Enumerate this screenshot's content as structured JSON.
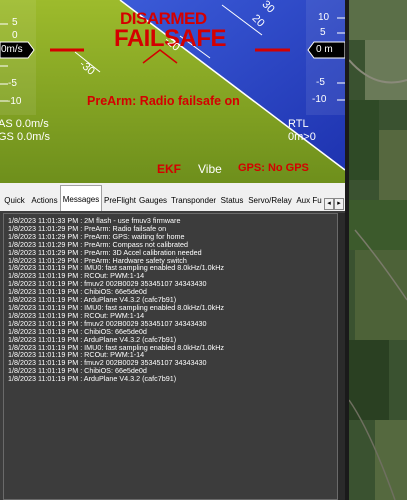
{
  "hud": {
    "status_armed": "DISARMED",
    "status_failsafe": "FAILSAFE",
    "prearm_message": "PreArm: Radio failsafe on",
    "left_speed_box": "0m/s",
    "right_alt_box": "0 m",
    "left_scale": [
      "5",
      "0",
      "-5",
      "-10"
    ],
    "right_scale": [
      "10",
      "5",
      "-5",
      "-10"
    ],
    "pitch_labels": [
      "30",
      "20",
      "-30",
      "-20"
    ],
    "airspeed": "AS 0.0m/s",
    "groundspeed": "GS 0.0m/s",
    "mode": "RTL",
    "home_dist": "0m>0",
    "ekf": "EKF",
    "vibe": "Vibe",
    "gps": "GPS: No GPS",
    "colors": {
      "sky": "#2e49c8",
      "ground": "#8fb02a",
      "alert": "#d40000"
    }
  },
  "tabs": {
    "items": [
      "Quick",
      "Actions",
      "Messages",
      "PreFlight",
      "Gauges",
      "Transponder",
      "Status",
      "Servo/Relay",
      "Aux Fu"
    ],
    "active": "Messages",
    "scroll_left": "◂",
    "scroll_right": "▸"
  },
  "messages": [
    "1/8/2023 11:01:33 PM : 2M flash - use fmuv3 firmware",
    "1/8/2023 11:01:29 PM : PreArm: Radio failsafe on",
    "1/8/2023 11:01:29 PM : PreArm: GPS: waiting for home",
    "1/8/2023 11:01:29 PM : PreArm: Compass not calibrated",
    "1/8/2023 11:01:29 PM : PreArm: 3D Accel calibration needed",
    "1/8/2023 11:01:29 PM : PreArm: Hardware safety switch",
    "1/8/2023 11:01:19 PM : IMU0: fast sampling enabled 8.0kHz/1.0kHz",
    "1/8/2023 11:01:19 PM : RCOut: PWM:1-14",
    "1/8/2023 11:01:19 PM : fmuv2 002B0029 35345107 34343430",
    "1/8/2023 11:01:19 PM : ChibiOS: 66e5de0d",
    "1/8/2023 11:01:19 PM : ArduPlane V4.3.2 (cafc7b91)",
    "1/8/2023 11:01:19 PM : IMU0: fast sampling enabled 8.0kHz/1.0kHz",
    "1/8/2023 11:01:19 PM : RCOut: PWM:1-14",
    "1/8/2023 11:01:19 PM : fmuv2 002B0029 35345107 34343430",
    "1/8/2023 11:01:19 PM : ChibiOS: 66e5de0d",
    "1/8/2023 11:01:19 PM : ArduPlane V4.3.2 (cafc7b91)",
    "1/8/2023 11:01:19 PM : IMU0: fast sampling enabled 8.0kHz/1.0kHz",
    "1/8/2023 11:01:19 PM : RCOut: PWM:1-14",
    "1/8/2023 11:01:19 PM : fmuv2 002B0029 35345107 34343430",
    "1/8/2023 11:01:19 PM : ChibiOS: 66e5de0d",
    "1/8/2023 11:01:19 PM : ArduPlane V4.3.2 (cafc7b91)"
  ]
}
